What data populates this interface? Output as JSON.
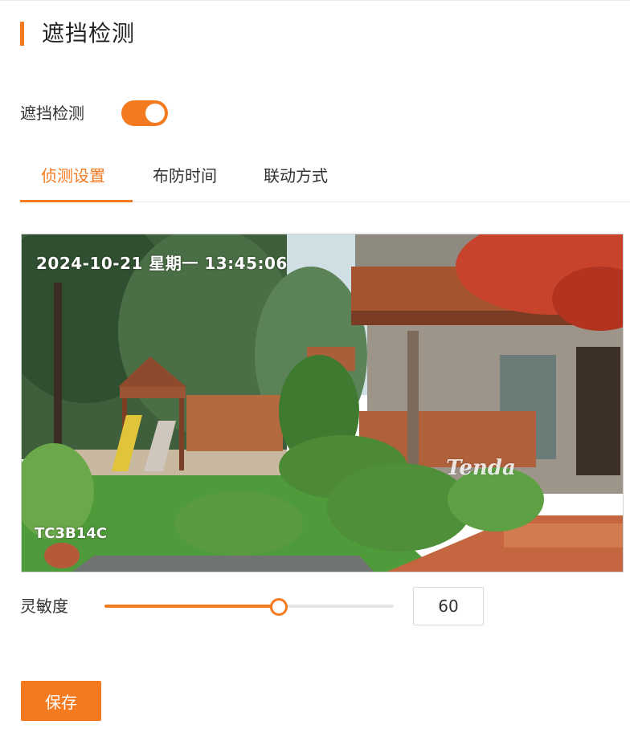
{
  "page": {
    "title": "遮挡检测"
  },
  "toggle": {
    "label": "遮挡检测",
    "enabled": true
  },
  "tabs": [
    {
      "label": "侦测设置",
      "active": true
    },
    {
      "label": "布防时间",
      "active": false
    },
    {
      "label": "联动方式",
      "active": false
    }
  ],
  "video": {
    "timestamp": "2024-10-21 星期一 13:45:06",
    "camera_name": "TC3B14C",
    "watermark": "Tenda"
  },
  "sensitivity": {
    "label": "灵敏度",
    "value": "60",
    "fraction": 0.6
  },
  "actions": {
    "save_label": "保存"
  },
  "colors": {
    "accent": "#f47a20"
  }
}
